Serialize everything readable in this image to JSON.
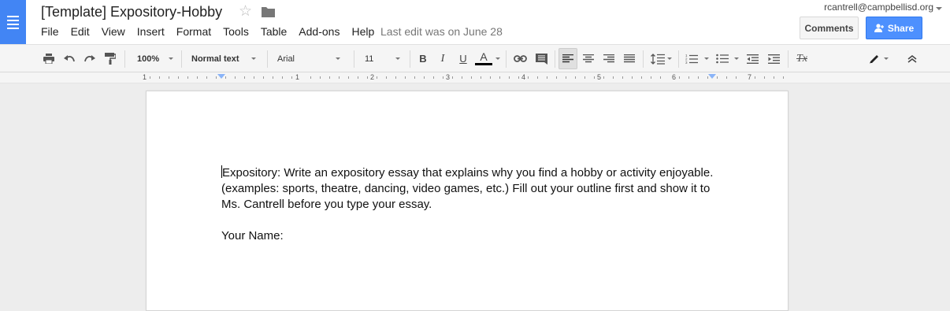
{
  "document": {
    "title": "[Template] Expository-Hobby",
    "last_edit": "Last edit was on June 28"
  },
  "account": {
    "email": "rcantrell@campbellisd.org"
  },
  "header": {
    "comments_label": "Comments",
    "share_label": "Share"
  },
  "menu": [
    "File",
    "Edit",
    "View",
    "Insert",
    "Format",
    "Tools",
    "Table",
    "Add-ons",
    "Help"
  ],
  "toolbar": {
    "zoom": "100%",
    "style": "Normal text",
    "font": "Arial",
    "font_size": "11",
    "bold": "B",
    "italic": "I",
    "underline": "U",
    "text_color_glyph": "A",
    "clear_format_glyph": "Tx",
    "icons": [
      "print-icon",
      "undo-icon",
      "redo-icon",
      "paint-format-icon",
      "link-icon",
      "comment-icon",
      "align-left-icon",
      "align-center-icon",
      "align-right-icon",
      "justify-icon",
      "line-spacing-icon",
      "numbered-list-icon",
      "bulleted-list-icon",
      "decrease-indent-icon",
      "increase-indent-icon",
      "clear-formatting-icon",
      "editing-pencil-icon",
      "collapse-toolbar-icon"
    ],
    "active_alignment": "left",
    "text_color": "#000000"
  },
  "ruler": {
    "labels": [
      "1",
      "1",
      "2",
      "3",
      "4",
      "5",
      "6",
      "7"
    ]
  },
  "body": {
    "paragraph1": "Expository: Write an expository essay that explains why you find a hobby or activity enjoyable. (examples: sports, theatre, dancing, video games, etc.) Fill out your outline first and show it to Ms. Cantrell before you type your essay.",
    "paragraph2": "Your Name:"
  },
  "colors": {
    "brand_blue": "#4285f4",
    "share_blue": "#4d90fe"
  }
}
